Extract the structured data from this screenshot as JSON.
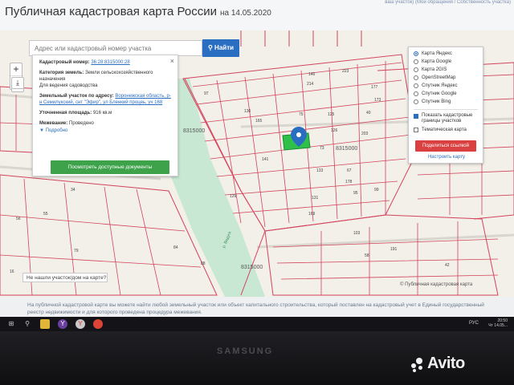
{
  "header": {
    "title": "Публичная кадастровая карта России",
    "date": "на 14.05.2020",
    "top_link": "ваш участок) (Мои обращения / Собственность участка)"
  },
  "map_controls": {
    "zoom_in": "+",
    "zoom_out": "−",
    "print_icon": "print-icon",
    "download_icon": "download-icon"
  },
  "search": {
    "placeholder": "Адрес или кадастровый номер участка",
    "button_label": "Найти"
  },
  "info_panel": {
    "close": "×",
    "cadastral_label": "Кадастровый номер:",
    "cadastral_value": "36:28:8315000:28",
    "category_label": "Категория земель:",
    "category_value": "Земли сельскохозяйственного назначения",
    "purpose_value": "Для ведения садоводства",
    "address_label": "Земельный участок по адресу:",
    "address_value": "Воронежская область, р-н Семилукский, снт \"Эфир\", ул Бленкий процеь, уч 168",
    "area_label": "Уточненная площадь:",
    "area_value": "916 кв.м",
    "survey_label": "Межевание:",
    "survey_value": "Проведено",
    "more_link": "▼ Подробно",
    "docs_button": "Посмотреть доступные документы"
  },
  "layer_panel": {
    "options": [
      {
        "label": "Карта Яндекс",
        "selected": true
      },
      {
        "label": "Карта Google",
        "selected": false
      },
      {
        "label": "Карта 2GIS",
        "selected": false
      },
      {
        "label": "OpenStreetMap",
        "selected": false
      },
      {
        "label": "Спутник Яндекс",
        "selected": false
      },
      {
        "label": "Спутник Google",
        "selected": false
      },
      {
        "label": "Спутник Bing",
        "selected": false
      }
    ],
    "checkboxes": [
      {
        "label": "Показать кадастровые границы участков",
        "checked": true
      },
      {
        "label": "Тематическая карта",
        "checked": false
      }
    ],
    "share_button": "Поделиться ссылкой",
    "setup_link": "Настроить карту"
  },
  "map_labels": {
    "quarter_main": "8315000",
    "quarter_center": "8315000",
    "quarter_bottom": "8315000",
    "river": "р. Ведуга",
    "plots": [
      "146",
      "214",
      "223",
      "177",
      "173",
      "125",
      "40",
      "203",
      "165",
      "126",
      "73",
      "133",
      "67",
      "178",
      "95",
      "99",
      "130",
      "141",
      "129",
      "131",
      "169",
      "58",
      "75",
      "34",
      "55",
      "56",
      "79",
      "84",
      "88",
      "103",
      "97",
      "191",
      "16",
      "42"
    ]
  },
  "notfound_label": "Не нашли участок/дом на карте?",
  "copyright": "© Публичная кадастровая карта",
  "footer_text": "На публичной кадастровой карте вы можете найти любой земельный участок или объект капитального строительства, который поставлен на кадастровый учет в Единый государственный реестр недвижимости и для которого проведена процедура межевания.",
  "taskbar": {
    "lang": "РУС",
    "time": "20:50",
    "date": "Чт 14.05..."
  },
  "bezel": {
    "brand": "SAMSUNG",
    "watermark": "Avito"
  },
  "colors": {
    "accent_blue": "#2a6ec2",
    "plot_border": "#d2445c",
    "selected_plot": "#2fc04a",
    "docs_button": "#3ea24a",
    "share_button": "#d9403f"
  }
}
